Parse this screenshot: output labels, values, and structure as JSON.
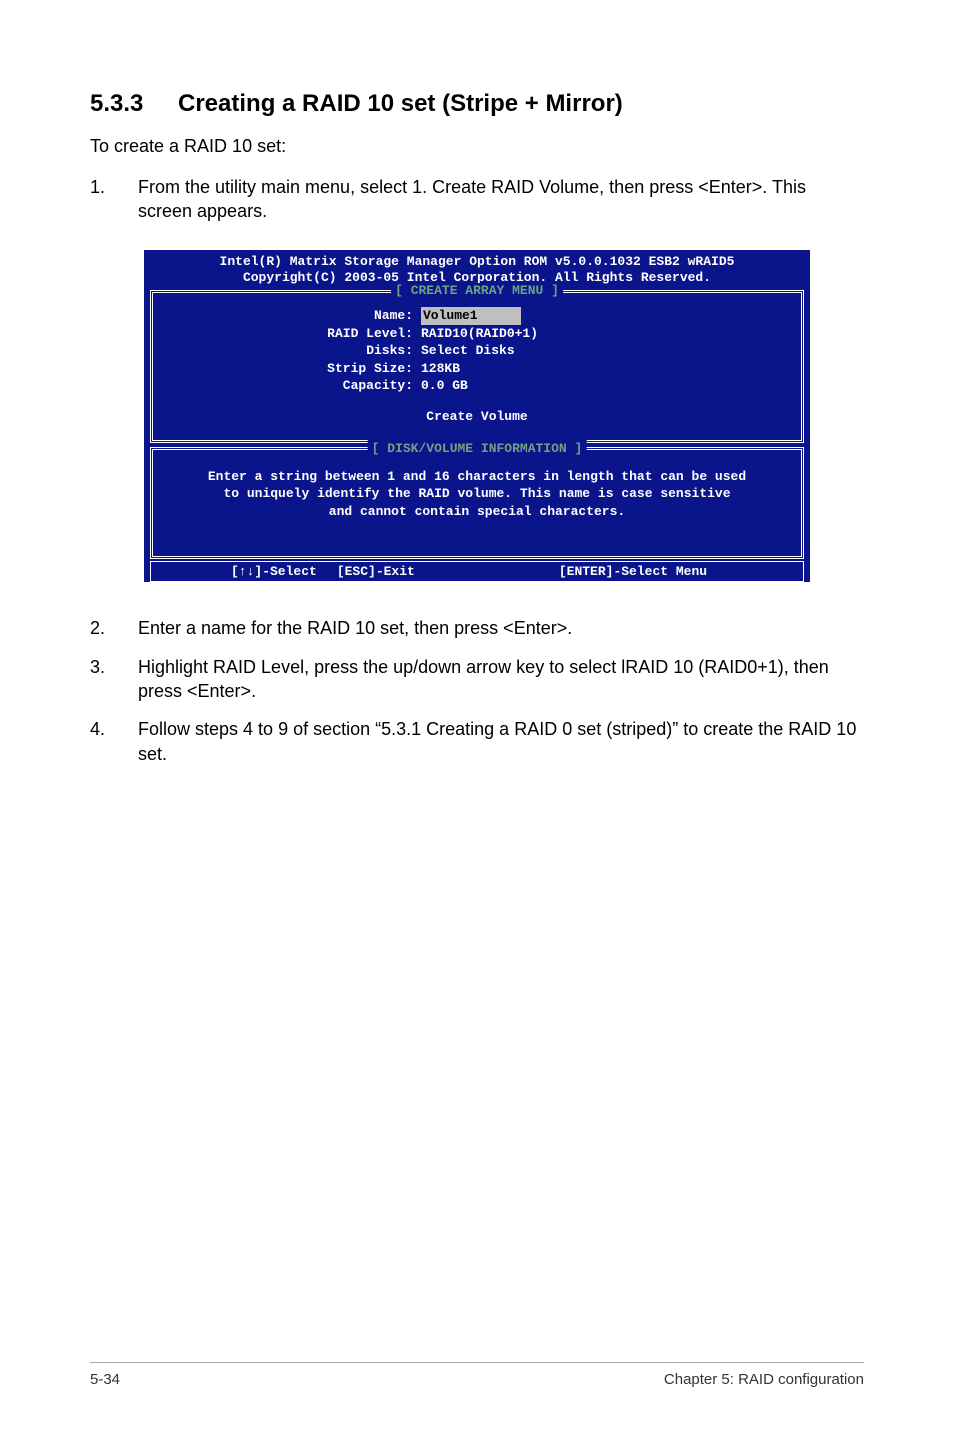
{
  "heading": {
    "number": "5.3.3",
    "title": "Creating a RAID 10 set (Stripe + Mirror)"
  },
  "intro": "To create a RAID 10 set:",
  "step1": {
    "num": "1.",
    "text": "From the utility main menu, select 1. Create RAID Volume, then press <Enter>. This screen appears."
  },
  "bios": {
    "header_line1": "Intel(R) Matrix Storage Manager Option ROM v5.0.0.1032 ESB2 wRAID5",
    "header_line2": "Copyright(C) 2003-05 Intel Corporation. All Rights Reserved.",
    "panel1_title": "[ CREATE ARRAY MENU ]",
    "fields": {
      "name_label": "Name:",
      "name_value": "Volume1",
      "raid_level_label": "RAID Level:",
      "raid_level_value": "RAID10(RAID0+1)",
      "disks_label": "Disks:",
      "disks_value": "Select Disks",
      "strip_size_label": "Strip Size:",
      "strip_size_value": "128KB",
      "capacity_label": "Capacity:",
      "capacity_value": "0.0   GB"
    },
    "create_volume": "Create Volume",
    "panel2_title": "[ DISK/VOLUME INFORMATION ]",
    "info_line1": "Enter a string between 1 and 16 characters in length that can be used",
    "info_line2": "to uniquely identify the RAID volume. This name is case sensitive",
    "info_line3": "and cannot contain special characters.",
    "footer_select": "[↑↓]-Select",
    "footer_esc": "[ESC]-Exit",
    "footer_enter": "[ENTER]-Select Menu"
  },
  "step2": {
    "num": "2.",
    "text": "Enter a name for the RAID 10  set, then press <Enter>."
  },
  "step3": {
    "num": "3.",
    "text": "Highlight RAID Level, press the up/down arrow key to select lRAID 10 (RAID0+1), then press <Enter>."
  },
  "step4": {
    "num": "4.",
    "text": "Follow steps 4 to 9 of section “5.3.1 Creating a RAID 0 set (striped)” to create the RAID 10 set."
  },
  "footer": {
    "left": "5-34",
    "right": "Chapter 5: RAID configuration"
  }
}
